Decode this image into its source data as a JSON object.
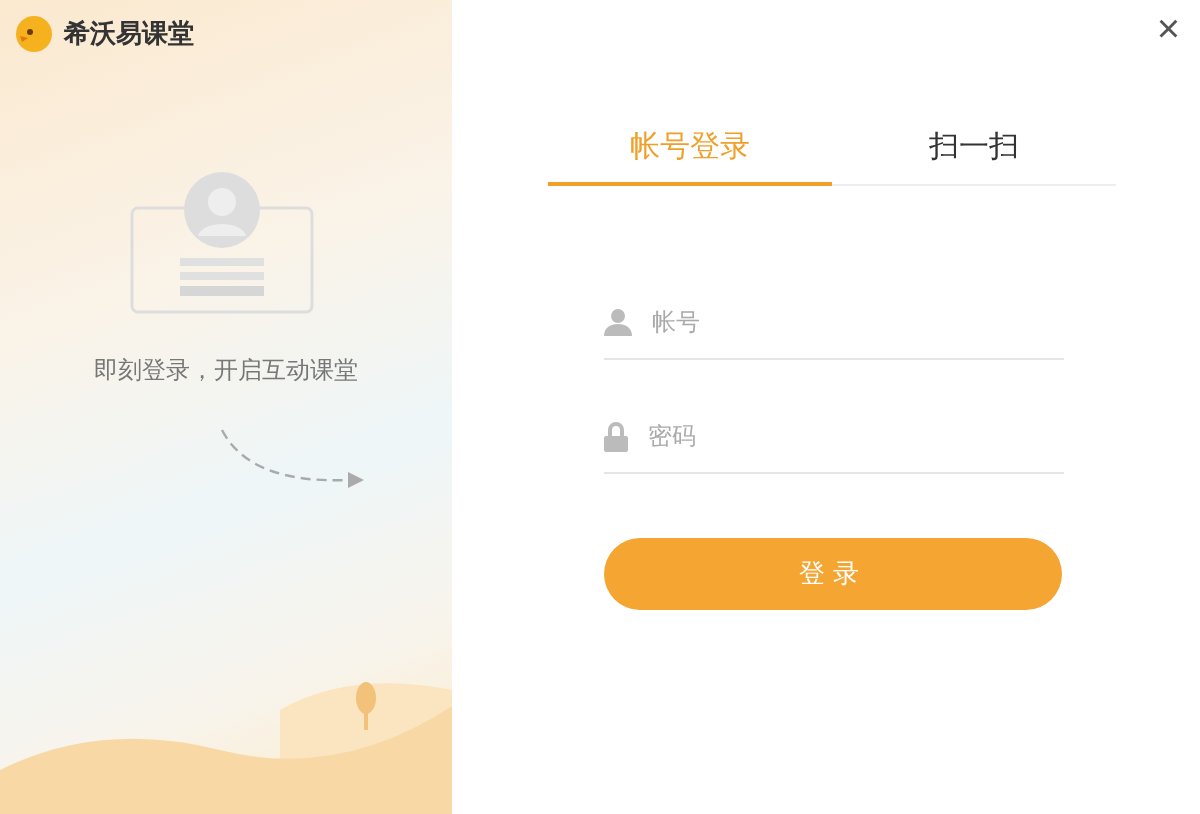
{
  "app": {
    "title": "希沃易课堂"
  },
  "promo": {
    "slogan": "即刻登录，开启互动课堂"
  },
  "tabs": [
    {
      "label": "帐号登录",
      "selected": true
    },
    {
      "label": "扫一扫",
      "selected": false
    }
  ],
  "fields": [
    {
      "kind": "text",
      "placeholder": "帐号"
    },
    {
      "kind": "password",
      "placeholder": "密码"
    }
  ],
  "login_button": "登录",
  "close": "×"
}
